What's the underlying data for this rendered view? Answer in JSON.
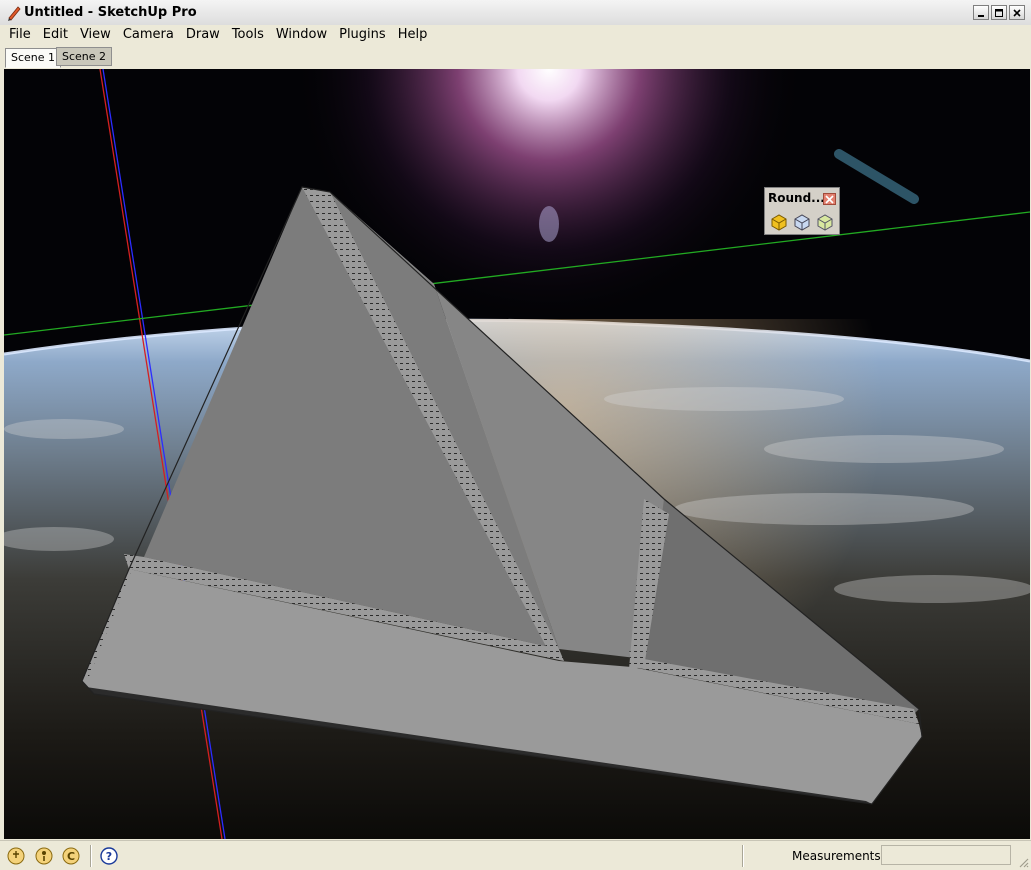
{
  "window": {
    "title": "Untitled - SketchUp Pro"
  },
  "menu": [
    "File",
    "Edit",
    "View",
    "Camera",
    "Draw",
    "Tools",
    "Window",
    "Plugins",
    "Help"
  ],
  "scenes": [
    "Scene 1",
    "Scene 2"
  ],
  "roundcorner_toolbar": {
    "title": "Round...",
    "tools": [
      "round-corner-tool-icon",
      "sharp-corner-tool-icon",
      "bevel-tool-icon"
    ]
  },
  "statusbar": {
    "icons": [
      "geolocation-icon",
      "credits-icon",
      "user-icon",
      "help-icon"
    ],
    "measurements_label": "Measurements",
    "measurements_value": ""
  },
  "colors": {
    "x_axis": "#d42020",
    "y_axis": "#22aa22",
    "z_axis": "#2c2cff",
    "model_fill": "#9a9a9a"
  }
}
